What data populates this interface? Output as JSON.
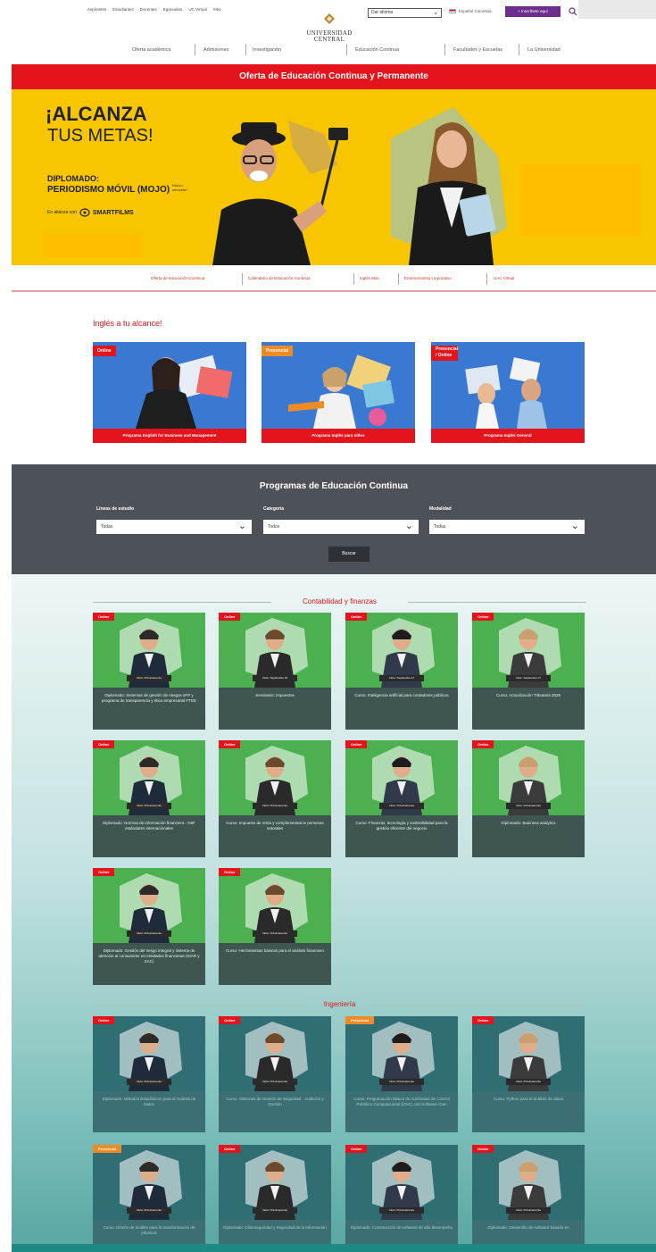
{
  "topbar": {
    "links": [
      "Aspirantes",
      "Estudiantes",
      "Docentes",
      "Egresados",
      "UC Virtual",
      "Sitio"
    ],
    "language_value": "Dar idioma",
    "flag_text": "Español Colombia",
    "apply_label": "+ Inscríbete aquí",
    "search_icon": "search-icon"
  },
  "logo": {
    "line1": "UNIVERSIDAD",
    "line2": "CENTRAL"
  },
  "mainnav": [
    "Oferta académica",
    "Admisiones",
    "Investigación",
    "Educación Continua",
    "Facultades y Escuelas",
    "La Universidad"
  ],
  "redbanner": {
    "text": "Oferta de Educación Continua y Permanente"
  },
  "hero": {
    "title1": "¡ALCANZA",
    "title2": "TUS METAS!",
    "diplomado1": "DIPLOMADO:",
    "diplomado2": "PERIODISMO MÓVIL (MOJO)",
    "tag": "Nuevo semestre",
    "ally_label": "En alianza con",
    "ally_brand": "SMARTFILMS"
  },
  "subnav": [
    "Oferta de Educación Continua",
    "Calendario de Educación Continua",
    "Inglés Mas",
    "Entrenamiento corporativo",
    "UAC Virtual"
  ],
  "ingles": {
    "title": "Inglés a tu alcance!",
    "cards": [
      {
        "tag": "Online",
        "label": "Programa English for Business and Management"
      },
      {
        "tag": "Presencial",
        "label": "Programa Inglés para niños"
      },
      {
        "tag": "Presencial / Online",
        "label": "Programa Inglés General"
      }
    ]
  },
  "filter": {
    "title": "Programas de Educación Continua",
    "labels": [
      "Líneas de estudio",
      "Categoría",
      "Modalidad"
    ],
    "values": [
      "Todas",
      "Todos",
      "Todas"
    ],
    "search_label": "Buscar"
  },
  "sections": [
    {
      "title": "Contabilidad y finanzas",
      "cards": [
        {
          "tag": "Online",
          "date": "Inicio: Próximamente",
          "name": "Diplomado: Sistemas de gestión de riesgos sPP y programa de transparencia y ética empresarial PTEE"
        },
        {
          "tag": "Online",
          "date": "Inicio: Septiembre 16",
          "name": "Seminario: Impuestos"
        },
        {
          "tag": "Online",
          "date": "Inicio: Septiembre 17",
          "name": "Curso: Inteligencia artificial para contadores públicos"
        },
        {
          "tag": "Online",
          "date": "Inicio: Septiembre 17",
          "name": "Curso: Actualización Tributaria 2025"
        },
        {
          "tag": "Online",
          "date": "Inicio: Próximamente",
          "name": "Diplomado: Normas de información financiera - NIIF estándares internacionales"
        },
        {
          "tag": "Online",
          "date": "Inicio: Próximamente",
          "name": "Curso: Impuesto de renta y complementarios personas naturales"
        },
        {
          "tag": "Online",
          "date": "Inicio: Próximamente",
          "name": "Curso: Finanzas, tecnología y sostenibilidad para la gestión eficiente del negocio"
        },
        {
          "tag": "Online",
          "date": "Inicio: Próximamente",
          "name": "Diplomado: Business analytics"
        },
        {
          "tag": "Online",
          "date": "Inicio: Próximamente",
          "name": "Diplomado: Gestión del riesgo integral y sistema de atención al consumidor en entidades financieras (SIAR y SAC)"
        },
        {
          "tag": "Online",
          "date": "Inicio: Próximamente",
          "name": "Curso: Herramientas básicas para el análisis financiero"
        }
      ]
    },
    {
      "title": "Ingeniería",
      "cards": [
        {
          "tag": "Online",
          "date": "Inicio: Próximamente",
          "name": "Diplomado: Métodos Estadísticos para el Análisis de Datos"
        },
        {
          "tag": "Online",
          "date": "Inicio: Próximamente",
          "name": "Curso: Sistemas de Gestión de Seguridad - Auditoría y Gestión"
        },
        {
          "tag": "Presencial",
          "date": "Inicio: Próximamente",
          "name": "Curso: Programación básica de Autómatas de Control Robótico Computacional (CNC) con Software Cam"
        },
        {
          "tag": "Online",
          "date": "Inicio: Próximamente",
          "name": "Curso: Python para el análisis de datos"
        },
        {
          "tag": "Presencial",
          "date": "Inicio: Próximamente",
          "name": "Curso: Diseño de moldes para la transformación de plásticos"
        },
        {
          "tag": "Online",
          "date": "Inicio: Próximamente",
          "name": "Diplomado: Ciberseguridad y Seguridad de la Información"
        },
        {
          "tag": "Online",
          "date": "Inicio: Próximamente",
          "name": "Diplomado: Construcción de software de alto desempeño"
        },
        {
          "tag": "Online",
          "date": "Inicio: Próximamente",
          "name": "Diplomado: Desarrollo de software basado en"
        }
      ]
    }
  ],
  "colors": {
    "red": "#e3141b",
    "yellow": "#f7c600",
    "green": "#4caf50",
    "darkgray": "#4d5158",
    "teal": "#1d8b84",
    "purple": "#6d2d8d"
  }
}
